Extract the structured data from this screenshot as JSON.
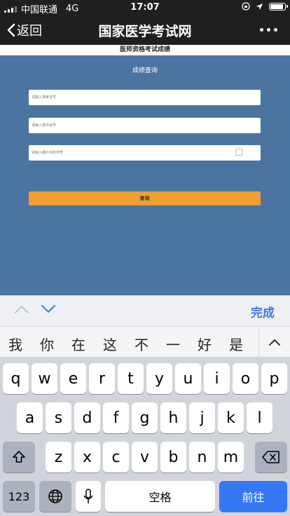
{
  "status": {
    "carrier": "中国联通",
    "network": "4G",
    "time": "17:07"
  },
  "nav": {
    "back_label": "返回",
    "title": "国家医学考试网"
  },
  "page": {
    "banner": "医师资格考试成绩",
    "query_title": "成绩查询",
    "fields": [
      {
        "placeholder": "请输入准考证号"
      },
      {
        "placeholder": "请输入身份证号"
      },
      {
        "placeholder": "请输入图片中的字符"
      }
    ],
    "submit_label": "查询"
  },
  "keyboard": {
    "done_label": "完成",
    "candidates": [
      "我",
      "你",
      "在",
      "这",
      "不",
      "一",
      "好",
      "是"
    ],
    "row1": [
      "q",
      "w",
      "e",
      "r",
      "t",
      "y",
      "u",
      "i",
      "o",
      "p"
    ],
    "row2": [
      "a",
      "s",
      "d",
      "f",
      "g",
      "h",
      "j",
      "k",
      "l"
    ],
    "row3": [
      "z",
      "x",
      "c",
      "v",
      "b",
      "n",
      "m"
    ],
    "numbers_label": "123",
    "space_label": "空格",
    "go_label": "前往",
    "accent_color": "#3478f6"
  }
}
